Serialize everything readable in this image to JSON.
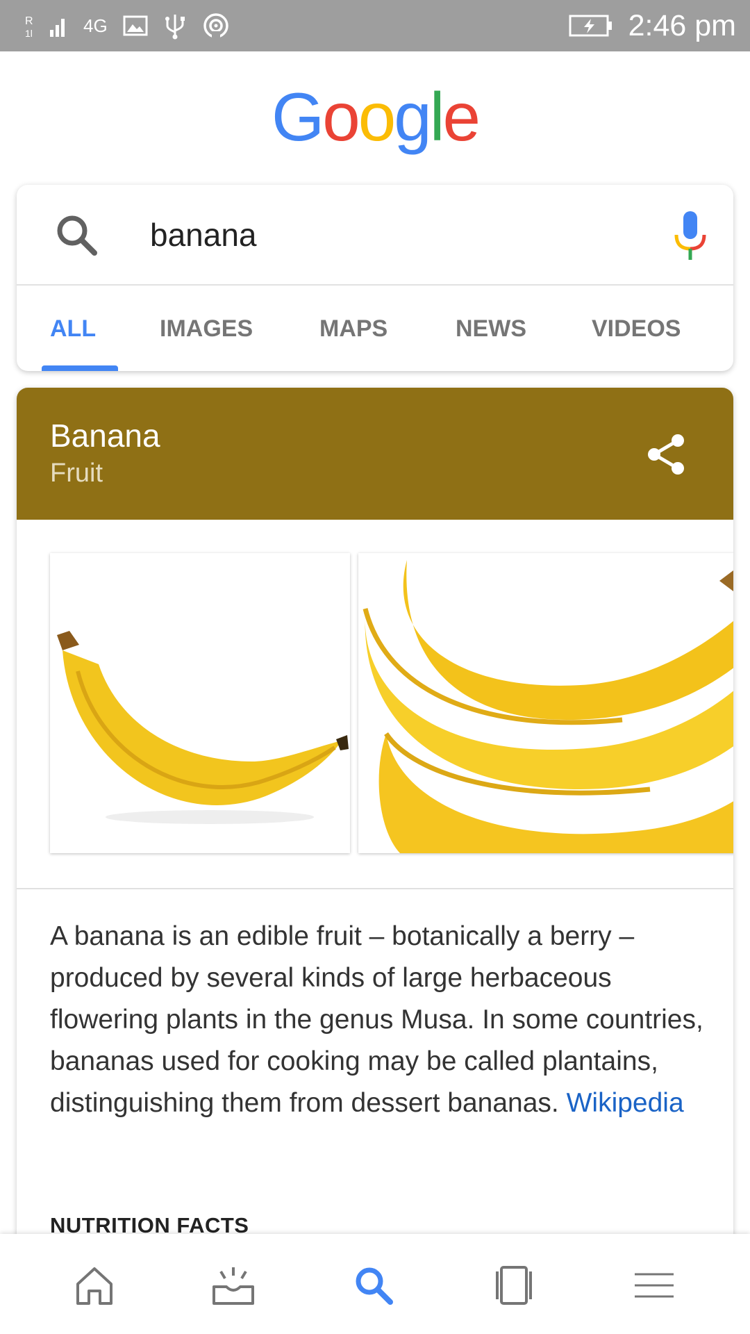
{
  "status_bar": {
    "network": "4G",
    "time": "2:46 pm",
    "icons": [
      "signal-icon",
      "gallery-icon",
      "usb-icon",
      "hotspot-icon",
      "battery-charging-icon"
    ]
  },
  "logo": {
    "letters": [
      "G",
      "o",
      "o",
      "g",
      "l",
      "e"
    ],
    "colors": [
      "#4285f4",
      "#ea4335",
      "#fbbc05",
      "#4285f4",
      "#34a853",
      "#ea4335"
    ]
  },
  "search": {
    "query": "banana",
    "icons": [
      "search-icon",
      "mic-icon"
    ]
  },
  "tabs": [
    {
      "label": "ALL",
      "active": true
    },
    {
      "label": "IMAGES",
      "active": false
    },
    {
      "label": "MAPS",
      "active": false
    },
    {
      "label": "NEWS",
      "active": false
    },
    {
      "label": "VIDEOS",
      "active": false
    }
  ],
  "knowledge_panel": {
    "title": "Banana",
    "subtitle": "Fruit",
    "header_color": "#8f7015",
    "share_icon": "share-icon",
    "images": [
      "banana-image",
      "banana-bunch-image"
    ],
    "description": "A banana is an edible fruit – botanically a berry – produced by several kinds of large herbaceous flowering plants in the genus Musa. In some countries, bananas used for cooking may be called plantains, distinguishing them from dessert bananas.",
    "source_link": "Wikipedia",
    "section_heading": "NUTRITION FACTS"
  },
  "bottom_nav": {
    "items": [
      "home-icon",
      "updates-icon",
      "search-icon",
      "tabs-icon",
      "menu-icon"
    ],
    "active_item": "search-icon",
    "accent": "#4285f4",
    "inactive": "#757575"
  }
}
